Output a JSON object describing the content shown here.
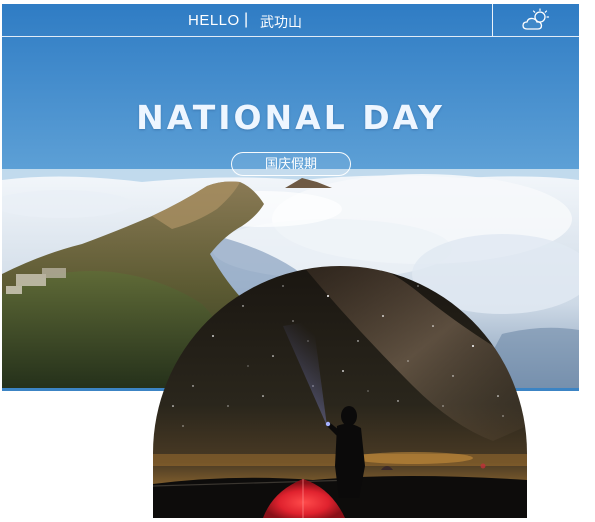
{
  "header": {
    "greeting": "HELLO",
    "separator": "|",
    "location": "武功山",
    "weather_icon": "partly-cloudy-icon"
  },
  "hero": {
    "headline": "NATIONAL DAY",
    "holiday_pill": "国庆假期"
  },
  "colors": {
    "sky_top": "#2f7cc4",
    "sky_bottom": "#b8d9ef",
    "night_sky": "#1a1712",
    "tent_red": "#e0222e",
    "accent_line": "#3c84c4"
  }
}
